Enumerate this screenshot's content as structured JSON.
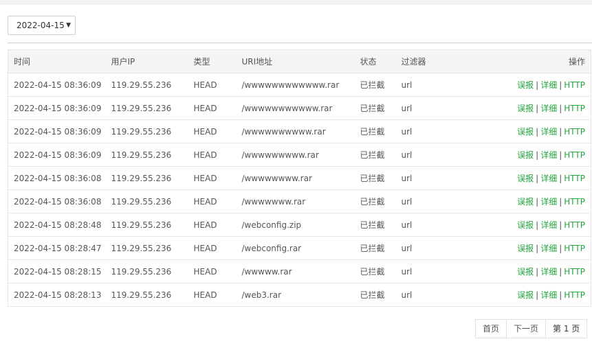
{
  "date_select": {
    "value": "2022-04-15"
  },
  "table": {
    "headers": {
      "time": "时间",
      "ip": "用户IP",
      "type": "类型",
      "uri": "URI地址",
      "status": "状态",
      "filter": "过滤器",
      "actions": "操作"
    },
    "rows": [
      {
        "time": "2022-04-15 08:36:09",
        "ip": "119.29.55.236",
        "type": "HEAD",
        "uri": "/wwwwwwwwwwww.rar",
        "status": "已拦截",
        "filter": "url"
      },
      {
        "time": "2022-04-15 08:36:09",
        "ip": "119.29.55.236",
        "type": "HEAD",
        "uri": "/wwwwwwwwwww.rar",
        "status": "已拦截",
        "filter": "url"
      },
      {
        "time": "2022-04-15 08:36:09",
        "ip": "119.29.55.236",
        "type": "HEAD",
        "uri": "/wwwwwwwwww.rar",
        "status": "已拦截",
        "filter": "url"
      },
      {
        "time": "2022-04-15 08:36:09",
        "ip": "119.29.55.236",
        "type": "HEAD",
        "uri": "/wwwwwwwww.rar",
        "status": "已拦截",
        "filter": "url"
      },
      {
        "time": "2022-04-15 08:36:08",
        "ip": "119.29.55.236",
        "type": "HEAD",
        "uri": "/wwwwwwww.rar",
        "status": "已拦截",
        "filter": "url"
      },
      {
        "time": "2022-04-15 08:36:08",
        "ip": "119.29.55.236",
        "type": "HEAD",
        "uri": "/wwwwwww.rar",
        "status": "已拦截",
        "filter": "url"
      },
      {
        "time": "2022-04-15 08:28:48",
        "ip": "119.29.55.236",
        "type": "HEAD",
        "uri": "/webconfig.zip",
        "status": "已拦截",
        "filter": "url"
      },
      {
        "time": "2022-04-15 08:28:47",
        "ip": "119.29.55.236",
        "type": "HEAD",
        "uri": "/webconfig.rar",
        "status": "已拦截",
        "filter": "url"
      },
      {
        "time": "2022-04-15 08:28:15",
        "ip": "119.29.55.236",
        "type": "HEAD",
        "uri": "/wwwww.rar",
        "status": "已拦截",
        "filter": "url"
      },
      {
        "time": "2022-04-15 08:28:13",
        "ip": "119.29.55.236",
        "type": "HEAD",
        "uri": "/web3.rar",
        "status": "已拦截",
        "filter": "url"
      }
    ],
    "actions": {
      "report": "误报",
      "detail": "详细",
      "http": "HTTP",
      "separator": "|"
    }
  },
  "pagination": {
    "first": "首页",
    "next": "下一页",
    "current": "第 1 页"
  },
  "colors": {
    "accent": "#20a53a",
    "border": "#e6e6e6",
    "header_bg": "#f5f5f5"
  }
}
